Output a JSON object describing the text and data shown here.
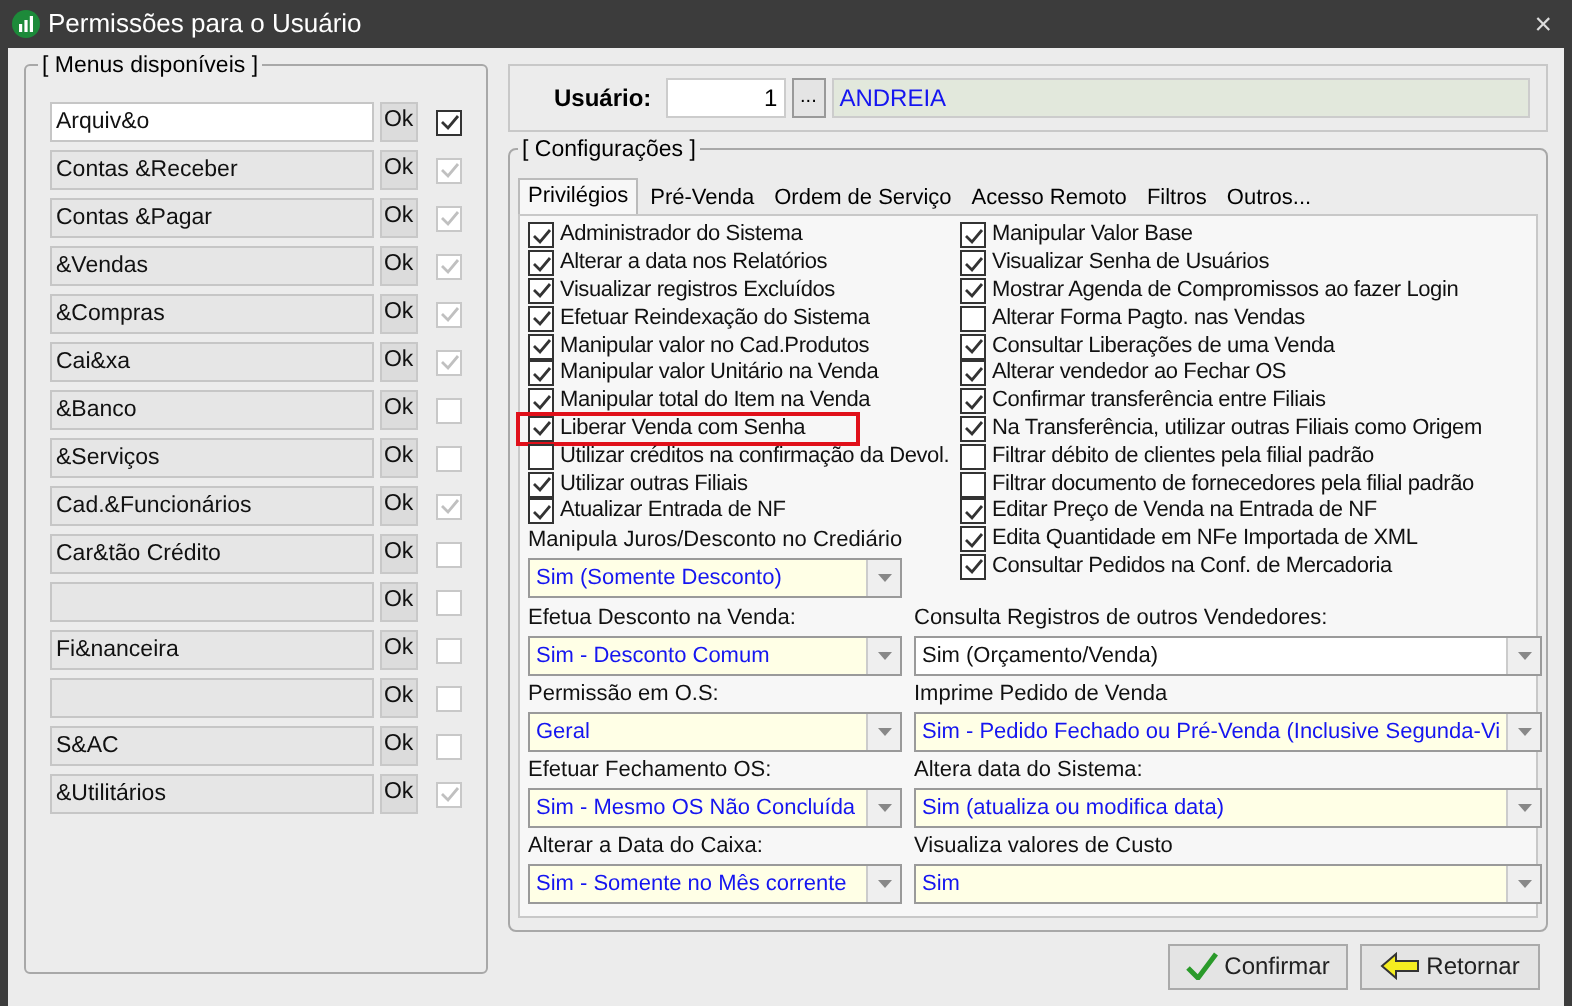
{
  "window": {
    "title": "Permissões para o Usuário",
    "close": "×"
  },
  "menus": {
    "title": "[ Menus disponíveis ]",
    "items": [
      {
        "label": "Arquiv&o",
        "button": "Ok",
        "checked": true,
        "disabled": false
      },
      {
        "label": "Contas &Receber",
        "button": "Ok",
        "checked": true,
        "disabled": true
      },
      {
        "label": "Contas &Pagar",
        "button": "Ok",
        "checked": true,
        "disabled": true
      },
      {
        "label": "&Vendas",
        "button": "Ok",
        "checked": true,
        "disabled": true
      },
      {
        "label": "&Compras",
        "button": "Ok",
        "checked": true,
        "disabled": true
      },
      {
        "label": "Cai&xa",
        "button": "Ok",
        "checked": true,
        "disabled": true
      },
      {
        "label": "&Banco",
        "button": "Ok",
        "checked": false,
        "disabled": true
      },
      {
        "label": "&Serviços",
        "button": "Ok",
        "checked": false,
        "disabled": true
      },
      {
        "label": "Cad.&Funcionários",
        "button": "Ok",
        "checked": true,
        "disabled": true
      },
      {
        "label": "Car&tão Crédito",
        "button": "Ok",
        "checked": false,
        "disabled": true
      },
      {
        "button": "Ok",
        "checked": false,
        "disabled": true
      },
      {
        "label": "Fi&nanceira",
        "button": "Ok",
        "checked": false,
        "disabled": true
      },
      {
        "button": "Ok",
        "checked": false,
        "disabled": true
      },
      {
        "label": "S&AC",
        "button": "Ok",
        "checked": false,
        "disabled": true
      },
      {
        "label": "&Utilitários",
        "button": "Ok",
        "checked": true,
        "disabled": true
      }
    ]
  },
  "user": {
    "label": "Usuário:",
    "code": "1",
    "lookup": "...",
    "name": "ANDREIA"
  },
  "config": {
    "title": "[ Configurações ]",
    "tabs": [
      {
        "label": "Privilégios",
        "selected": true
      },
      {
        "label": "Pré-Venda",
        "selected": false
      },
      {
        "label": "Ordem de Serviço",
        "selected": false
      },
      {
        "label": "Acesso Remoto",
        "selected": false
      },
      {
        "label": "Filtros",
        "selected": false
      },
      {
        "label": "Outros...",
        "selected": false
      }
    ],
    "left_options": [
      {
        "label": "Administrador do Sistema",
        "checked": true,
        "highlighted": false
      },
      {
        "label": "Alterar a data nos Relatórios",
        "checked": true,
        "highlighted": false
      },
      {
        "label": "Visualizar registros Excluídos",
        "checked": true,
        "highlighted": false
      },
      {
        "label": "Efetuar Reindexação do Sistema",
        "checked": true,
        "highlighted": false
      },
      {
        "label": "Manipular valor no Cad.Produtos",
        "checked": true,
        "highlighted": false
      },
      {
        "label": "Manipular valor Unitário na Venda",
        "checked": true,
        "highlighted": false
      },
      {
        "label": "Manipular total do Item na Venda",
        "checked": true,
        "highlighted": false
      },
      {
        "label": "Liberar Venda com Senha",
        "checked": true,
        "highlighted": true
      },
      {
        "label": "Utilizar créditos na confirmação da Devol.",
        "checked": false,
        "highlighted": false
      },
      {
        "label": "Utilizar outras Filiais",
        "checked": true,
        "highlighted": false
      },
      {
        "label": "Atualizar Entrada de NF",
        "checked": true,
        "highlighted": false
      }
    ],
    "right_options": [
      {
        "label": "Manipular Valor Base",
        "checked": true,
        "highlighted": false
      },
      {
        "label": "Visualizar Senha de Usuários",
        "checked": true,
        "highlighted": false
      },
      {
        "label": "Mostrar Agenda de Compromissos ao fazer Login",
        "checked": true,
        "highlighted": false
      },
      {
        "label": "Alterar Forma Pagto. nas Vendas",
        "checked": false,
        "highlighted": false
      },
      {
        "label": "Consultar Liberações de uma Venda",
        "checked": true,
        "highlighted": false
      },
      {
        "label": "Alterar vendedor ao Fechar OS",
        "checked": true,
        "highlighted": false
      },
      {
        "label": "Confirmar transferência entre Filiais",
        "checked": true,
        "highlighted": false
      },
      {
        "label": "Na Transferência, utilizar outras Filiais como Origem",
        "checked": true,
        "highlighted": false
      },
      {
        "label": "Filtrar débito de clientes pela filial padrão",
        "checked": false,
        "highlighted": false
      },
      {
        "label": "Filtrar documento de fornecedores pela filial padrão",
        "checked": false,
        "highlighted": false
      },
      {
        "label": "Editar Preço de Venda na Entrada de NF",
        "checked": true,
        "highlighted": false
      },
      {
        "label": "Edita Quantidade em NFe Importada de XML",
        "checked": true,
        "highlighted": false
      },
      {
        "label": "Consultar Pedidos na Conf. de Mercadoria",
        "checked": true,
        "highlighted": false
      }
    ],
    "first_select": {
      "label": "Manipula Juros/Desconto no Crediário",
      "value": "Sim (Somente Desconto)"
    },
    "selects": [
      {
        "label": "Efetua Desconto na Venda:",
        "value": "Sim - Desconto Comum",
        "kind": "highlighted"
      },
      {
        "label": "Consulta Registros de outros Vendedores:",
        "value": "Sim (Orçamento/Venda)",
        "kind": "plain"
      },
      {
        "label": "Permissão em O.S:",
        "value": "Geral",
        "kind": "highlighted"
      },
      {
        "label": "Imprime Pedido de Venda",
        "value": "Sim - Pedido Fechado ou Pré-Venda (Inclusive Segunda-Vi",
        "kind": "highlighted"
      },
      {
        "label": "Efetuar Fechamento OS:",
        "value": "Sim - Mesmo OS Não Concluída",
        "kind": "highlighted"
      },
      {
        "label": "Altera data do Sistema:",
        "value": "Sim (atualiza ou modifica data)",
        "kind": "highlighted"
      },
      {
        "label": "Alterar a Data do Caixa:",
        "value": "Sim - Somente no Mês corrente",
        "kind": "highlighted"
      },
      {
        "label": "Visualiza valores de Custo",
        "value": "Sim",
        "kind": "highlighted"
      }
    ]
  },
  "buttons": [
    {
      "label": "Confirmar",
      "kind": "confirm"
    },
    {
      "label": "Retornar",
      "kind": "back"
    }
  ]
}
